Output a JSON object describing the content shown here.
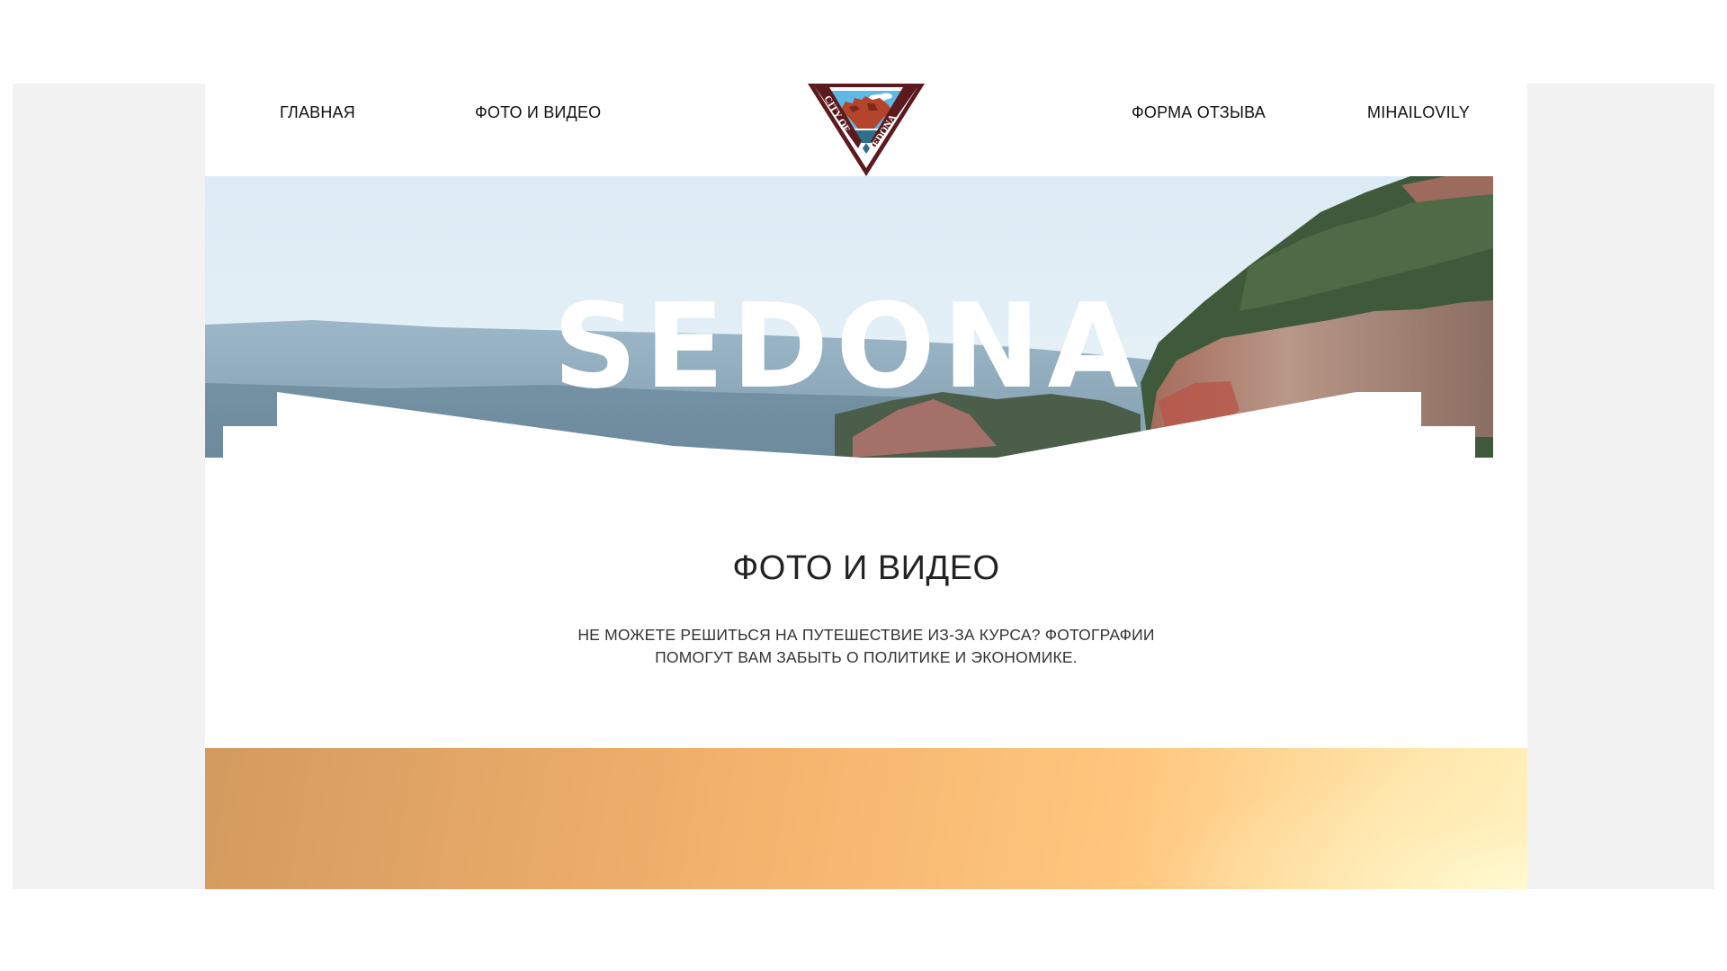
{
  "nav": {
    "home": "ГЛАВНАЯ",
    "photo_video": "ФОТО И ВИДЕО",
    "feedback": "ФОРМА ОТЗЫВА",
    "user": "MIHAILOVILY"
  },
  "logo": {
    "text_left": "CITY OF",
    "text_right": "SEDONA",
    "colors": {
      "border": "#5b1a1e",
      "sky": "#5fb8e6",
      "rock": "#b4442b"
    }
  },
  "hero": {
    "title": "SEDONA"
  },
  "intro": {
    "heading": "ФОТО И ВИДЕО",
    "text": "НЕ МОЖЕТЕ РЕШИТЬСЯ НА ПУТЕШЕСТВИЕ ИЗ-ЗА КУРСА? ФОТОГРАФИИ ПОМОГУТ ВАМ ЗАБЫТЬ О ПОЛИТИКЕ И ЭКОНОМИКЕ."
  },
  "colors": {
    "page_bg": "#f2f2f2",
    "content_bg": "#ffffff",
    "text": "#222222"
  }
}
